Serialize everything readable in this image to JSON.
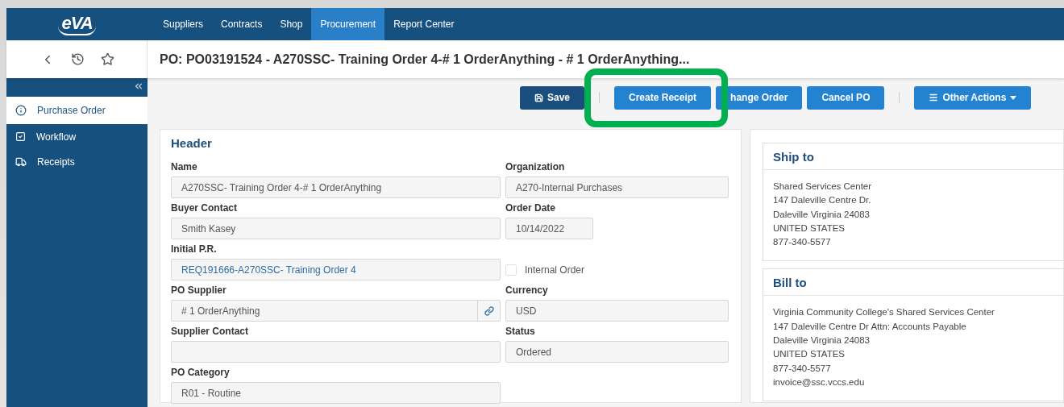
{
  "logo": {
    "text": "eVA"
  },
  "nav": [
    {
      "label": "Suppliers",
      "selected": false
    },
    {
      "label": "Contracts",
      "selected": false
    },
    {
      "label": "Shop",
      "selected": false
    },
    {
      "label": "Procurement",
      "selected": true
    },
    {
      "label": "Report Center",
      "selected": false
    }
  ],
  "page_title": "PO: PO03191524 - A270SSC- Training Order 4-# 1 OrderAnything - # 1 OrderAnything...",
  "sidebar": {
    "items": [
      {
        "label": "Purchase Order",
        "selected": true
      },
      {
        "label": "Workflow",
        "selected": false
      },
      {
        "label": "Receipts",
        "selected": false
      }
    ]
  },
  "toolbar": {
    "buttons": [
      {
        "label": "Save",
        "kind": "primary",
        "highlighted": false
      },
      {
        "kind": "separator"
      },
      {
        "label": "Create Receipt",
        "kind": "action",
        "highlighted": true
      },
      {
        "label": "hange Order",
        "kind": "action",
        "highlighted": false
      },
      {
        "label": "Cancel PO",
        "kind": "action",
        "highlighted": false
      },
      {
        "kind": "separator"
      },
      {
        "label": "Other Actions",
        "kind": "menu",
        "highlighted": false
      }
    ]
  },
  "header": {
    "title": "Header",
    "rows": [
      {
        "left": {
          "label": "Name",
          "value": "A270SSC- Training Order 4-# 1 OrderAnything",
          "kind": "text"
        },
        "right": {
          "label": "Organization",
          "value": "A270-Internal Purchases",
          "kind": "text"
        }
      },
      {
        "left": {
          "label": "Buyer Contact",
          "value": "Smith Kasey",
          "kind": "text"
        },
        "right": {
          "label": "Order Date",
          "value": "10/14/2022",
          "kind": "date"
        }
      },
      {
        "left": {
          "label": "Initial P.R.",
          "value": "REQ191666-A270SSC- Training Order 4",
          "kind": "link"
        },
        "right": {
          "label": "Internal Order",
          "kind": "checkbox",
          "checked": false
        }
      },
      {
        "left": {
          "label": "PO Supplier",
          "value": "# 1 OrderAnything",
          "kind": "lookup"
        },
        "right": {
          "label": "Currency",
          "value": "USD",
          "kind": "text"
        }
      },
      {
        "left": {
          "label": "Supplier Contact",
          "kind": "text"
        },
        "right": {
          "label": "Status",
          "value": "Ordered",
          "kind": "text"
        }
      },
      {
        "left": {
          "label": "PO Category",
          "value": "R01 - Routine",
          "kind": "text"
        }
      }
    ]
  },
  "addresses": [
    {
      "title": "Ship to",
      "lines": [
        "Shared Services Center",
        "147 Daleville Centre Dr.",
        "Daleville Virginia  24083",
        "UNITED STATES",
        "877-340-5577"
      ]
    },
    {
      "title": "Bill to",
      "lines": [
        "Virginia Community College's Shared Services Center",
        "147 Daleville Centre Dr Attn: Accounts Payable",
        "Daleville Virginia  24083",
        "UNITED STATES",
        "877-340-5577",
        "invoice@ssc.vccs.edu"
      ]
    }
  ]
}
